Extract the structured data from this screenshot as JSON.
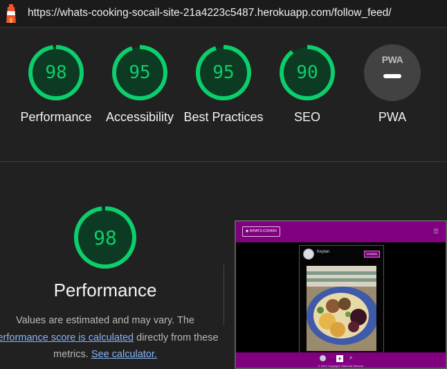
{
  "browser": {
    "url": "https://whats-cooking-socail-site-21a4223c5487.herokuapp.com/follow_feed/"
  },
  "summary_scores": [
    {
      "label": "Performance",
      "score": "98",
      "fraction": 0.98
    },
    {
      "label": "Accessibility",
      "score": "95",
      "fraction": 0.95
    },
    {
      "label": "Best Practices",
      "score": "95",
      "fraction": 0.95
    },
    {
      "label": "SEO",
      "score": "90",
      "fraction": 0.9
    }
  ],
  "pwa": {
    "badge_text": "PWA",
    "label": "PWA"
  },
  "performance_section": {
    "score": "98",
    "fraction": 0.98,
    "title": "Performance",
    "desc_line1": "Values are estimated and may vary. The",
    "link_score": "performance score is calculated",
    "desc_line2_rest": " directly from these",
    "desc_line3_prefix": "metrics. ",
    "link_calculator": "See calculator."
  },
  "thumbnail": {
    "logo_text": "WHATS-COOKIN",
    "menu_icon": "hamburger-icon",
    "user_name": "Keylan",
    "follow_button": "Unfollow",
    "copyright": "© 2023 Copyright: Diarmuid Sheeran"
  },
  "colors": {
    "score_good": "#0cce6b",
    "score_good_bg": "#0d3a22",
    "site_purple": "#80007f",
    "link": "#8ab4f8"
  }
}
